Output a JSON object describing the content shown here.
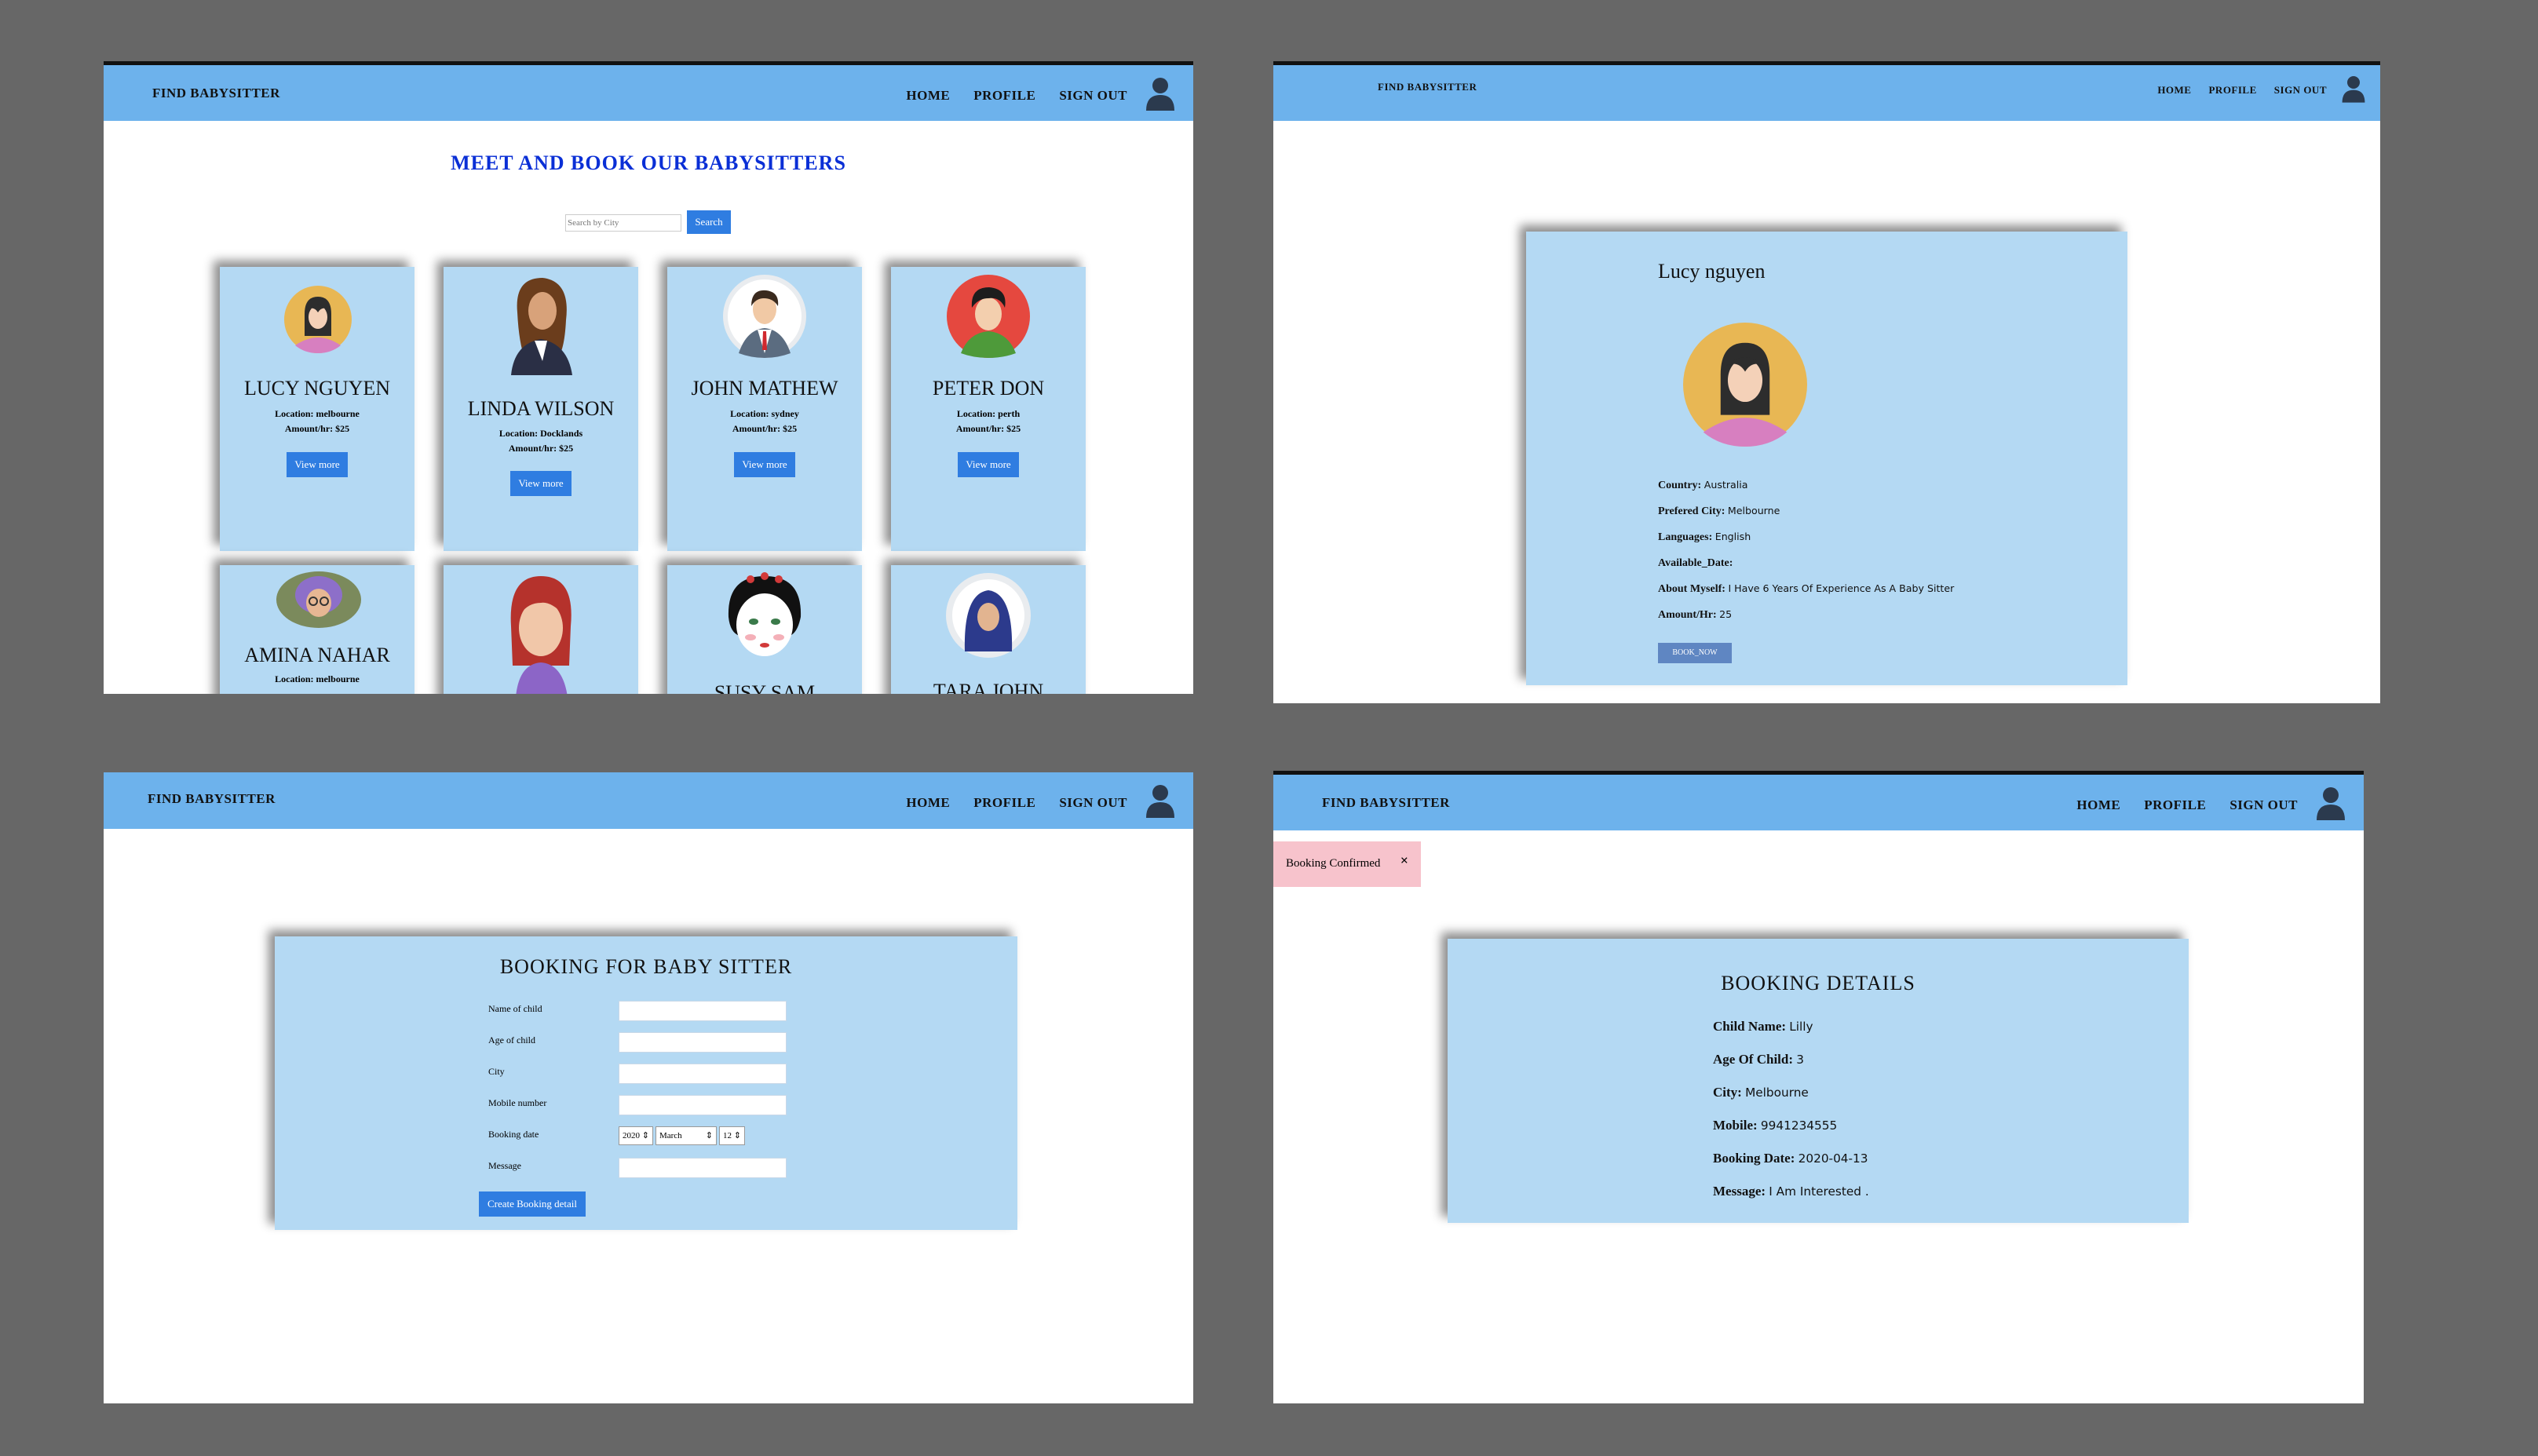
{
  "nav": {
    "brand": "FIND BABYSITTER",
    "home": "HOME",
    "profile": "PROFILE",
    "signout": "SIGN OUT"
  },
  "home": {
    "title": "MEET AND BOOK OUR BABYSITTERS",
    "search_placeholder": "Search by City",
    "search_button": "Search",
    "cards": [
      {
        "name": "LUCY NGUYEN",
        "location": "Location: melbourne",
        "amount": "Amount/hr: $25",
        "button": "View more"
      },
      {
        "name": "LINDA WILSON",
        "location": "Location: Docklands",
        "amount": "Amount/hr: $25",
        "button": "View more"
      },
      {
        "name": "JOHN MATHEW",
        "location": "Location: sydney",
        "amount": "Amount/hr: $25",
        "button": "View more"
      },
      {
        "name": "PETER DON",
        "location": "Location: perth",
        "amount": "Amount/hr: $25",
        "button": "View more"
      },
      {
        "name": "AMINA NAHAR",
        "location": "Location: melbourne"
      },
      {
        "name": ""
      },
      {
        "name": "SUSY SAM"
      },
      {
        "name": "TARA JOHN"
      }
    ]
  },
  "profile": {
    "name": "Lucy nguyen",
    "rows": [
      {
        "label": "Country:",
        "value": "Australia"
      },
      {
        "label": "Prefered City:",
        "value": "Melbourne"
      },
      {
        "label": "Languages:",
        "value": "English"
      },
      {
        "label": "Available_Date:",
        "value": ""
      },
      {
        "label": "About Myself:",
        "value": "I Have 6 Years Of Experience As A Baby Sitter"
      },
      {
        "label": "Amount/Hr:",
        "value": "25"
      }
    ],
    "book_button": "BOOK_NOW"
  },
  "booking": {
    "title": "BOOKING FOR BABY SITTER",
    "labels": [
      "Name of child",
      "Age of child",
      "City",
      "Mobile number",
      "Booking date",
      "Message"
    ],
    "date": {
      "year": "2020",
      "month": "March",
      "day": "12"
    },
    "submit": "Create Booking detail"
  },
  "details": {
    "alert": "Booking Confirmed",
    "alert_close": "×",
    "title": "BOOKING DETAILS",
    "rows": [
      {
        "label": "Child Name:",
        "value": "Lilly"
      },
      {
        "label": "Age Of Child:",
        "value": "3"
      },
      {
        "label": "City:",
        "value": "Melbourne"
      },
      {
        "label": "Mobile:",
        "value": "9941234555"
      },
      {
        "label": "Booking Date:",
        "value": "2020-04-13"
      },
      {
        "label": "Message:",
        "value": "I Am Interested ."
      }
    ]
  },
  "colors": {
    "navbar": "#6db2ec",
    "card": "#b4d9f3",
    "button": "#2f7de1",
    "title_blue": "#0a2fd6",
    "alert": "#f7c3cc"
  }
}
